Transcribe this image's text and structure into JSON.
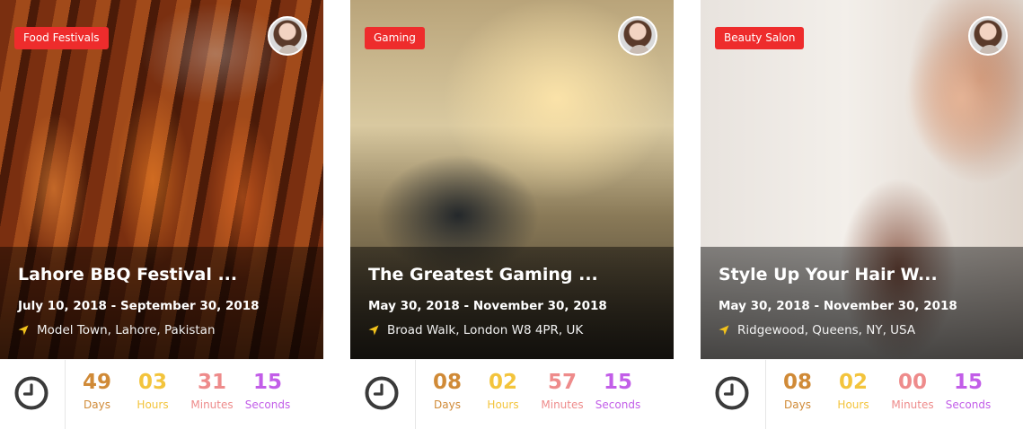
{
  "colors": {
    "tag_bg": "#ee2c2c",
    "days": "#d08a37",
    "hours": "#f3c43c",
    "minutes": "#ee8b8b",
    "seconds": "#c25de8",
    "pin": "#f2c21b",
    "clock": "#3a3a3a"
  },
  "cards": [
    {
      "category": "Food Festivals",
      "title": "Lahore BBQ Festival ...",
      "dates": "July 10, 2018 - September 30, 2018",
      "location": "Model Town, Lahore, Pakistan",
      "image": "bbq-skewers-photo",
      "countdown": [
        {
          "value": "49",
          "label": "Days"
        },
        {
          "value": "03",
          "label": "Hours"
        },
        {
          "value": "31",
          "label": "Minutes"
        },
        {
          "value": "15",
          "label": "Seconds"
        }
      ]
    },
    {
      "category": "Gaming",
      "title": "The Greatest Gaming ...",
      "dates": "May 30, 2018 - November 30, 2018",
      "location": "Broad Walk, London W8 4PR, UK",
      "image": "rally-car-photo",
      "countdown": [
        {
          "value": "08",
          "label": "Days"
        },
        {
          "value": "02",
          "label": "Hours"
        },
        {
          "value": "57",
          "label": "Minutes"
        },
        {
          "value": "15",
          "label": "Seconds"
        }
      ]
    },
    {
      "category": "Beauty Salon",
      "title": "Style Up Your Hair W...",
      "dates": "May 30, 2018 - November 30, 2018",
      "location": "Ridgewood, Queens, NY, USA",
      "image": "hair-salon-photo",
      "countdown": [
        {
          "value": "08",
          "label": "Days"
        },
        {
          "value": "02",
          "label": "Hours"
        },
        {
          "value": "00",
          "label": "Minutes"
        },
        {
          "value": "15",
          "label": "Seconds"
        }
      ]
    }
  ],
  "icons": {
    "avatar": "avatar",
    "pin": "location-arrow-icon",
    "clock": "clock-icon"
  }
}
